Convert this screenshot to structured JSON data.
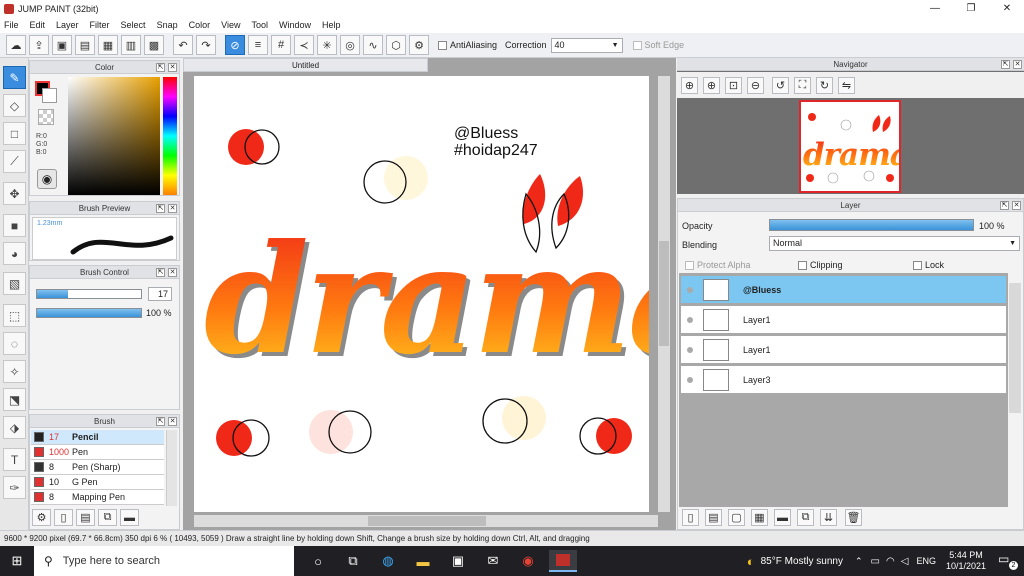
{
  "window": {
    "title": "JUMP PAINT (32bit)",
    "minimize": "—",
    "restore": "❐",
    "close": "✕"
  },
  "menu": [
    "File",
    "Edit",
    "Layer",
    "Filter",
    "Select",
    "Snap",
    "Color",
    "View",
    "Tool",
    "Window",
    "Help"
  ],
  "toolbar": {
    "antialiasing_label": "AntiAliasing",
    "correction_label": "Correction",
    "correction_value": "40",
    "softedge_label": "Soft Edge"
  },
  "color_panel": {
    "title": "Color",
    "r": "R:0",
    "g": "G:0",
    "b": "B:0",
    "fg": "#000000",
    "bg": "#ffffff"
  },
  "brush_preview": {
    "title": "Brush Preview",
    "size": "1.23mm"
  },
  "brush_control": {
    "title": "Brush Control",
    "size": "17",
    "opacity": "100 %",
    "size_fraction": 0.3,
    "opacity_fraction": 1.0
  },
  "brush_panel": {
    "title": "Brush",
    "items": [
      {
        "size": "17",
        "name": "Pencil",
        "selected": true
      },
      {
        "size": "1000",
        "name": "Pen",
        "selected": false
      },
      {
        "size": "8",
        "name": "Pen (Sharp)",
        "selected": false
      },
      {
        "size": "10",
        "name": "G Pen",
        "selected": false
      },
      {
        "size": "8",
        "name": "Mapping Pen",
        "selected": false
      }
    ]
  },
  "document": {
    "tab": "Untitled",
    "watermark_line1": "@Bluess",
    "watermark_line2": "#hoidap247",
    "art_text": "drama"
  },
  "navigator": {
    "title": "Navigator"
  },
  "layer_panel": {
    "title": "Layer",
    "opacity_label": "Opacity",
    "opacity_value": "100 %",
    "blending_label": "Blending",
    "blending_value": "Normal",
    "protect_alpha": "Protect Alpha",
    "clipping": "Clipping",
    "lock": "Lock",
    "layers": [
      {
        "name": "@Bluess",
        "selected": true
      },
      {
        "name": "Layer1",
        "selected": false
      },
      {
        "name": "Layer1",
        "selected": false
      },
      {
        "name": "Layer3",
        "selected": false
      }
    ]
  },
  "status": {
    "text": "9600 * 9200 pixel  (69.7 * 66.8cm)   350 dpi   6 %   ( 10493, 5059 )   Draw a straight line by holding down Shift, Change a brush size by holding down Ctrl, Alt, and dragging"
  },
  "taskbar": {
    "search_placeholder": "Type here to search",
    "weather": "85°F  Mostly sunny",
    "lang": "ENG",
    "time": "5:44 PM",
    "date": "10/1/2021",
    "notifications": "2"
  },
  "colors": {
    "accent": "#3a8dde",
    "red": "#f02818",
    "orange": "#ffb000",
    "selected_layer": "#7cc7f2"
  }
}
